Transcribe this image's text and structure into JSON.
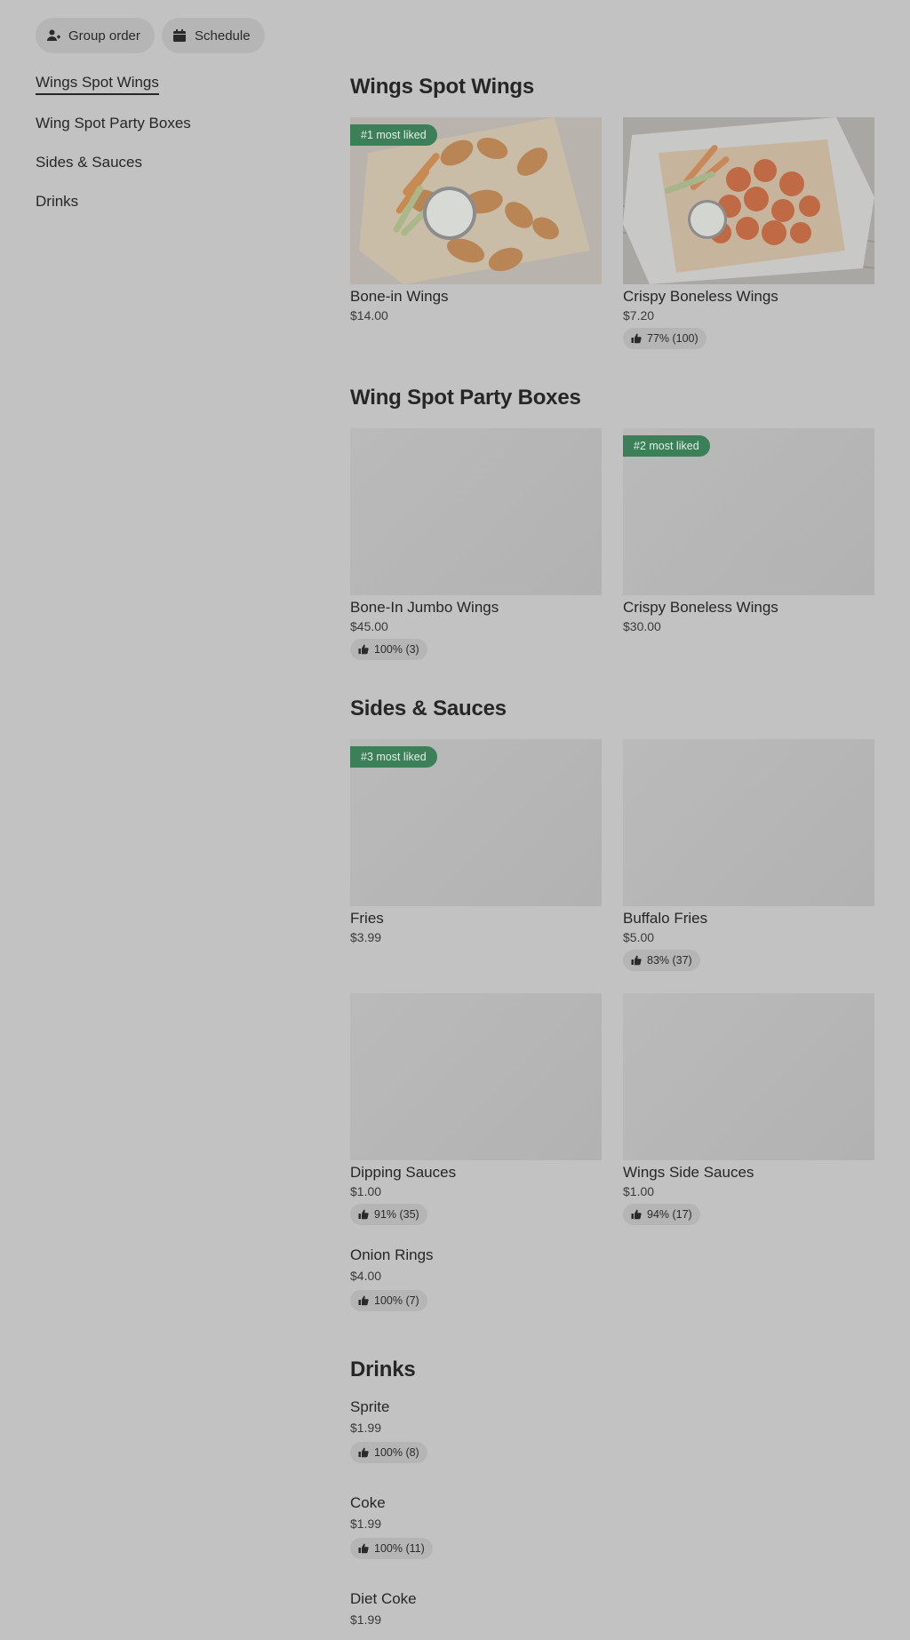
{
  "top_buttons": {
    "group_order": "Group order",
    "schedule": "Schedule"
  },
  "sidebar": {
    "items": [
      {
        "label": "Wings Spot Wings",
        "active": true
      },
      {
        "label": "Wing Spot Party Boxes",
        "active": false
      },
      {
        "label": "Sides & Sauces",
        "active": false
      },
      {
        "label": "Drinks",
        "active": false
      }
    ]
  },
  "sections": {
    "wings": {
      "title": "Wings Spot Wings",
      "items": [
        {
          "name": "Bone-in Wings",
          "price": "$14.00",
          "badge": "#1 most liked"
        },
        {
          "name": "Crispy Boneless Wings",
          "price": "$7.20",
          "rating": "77% (100)"
        }
      ]
    },
    "party_boxes": {
      "title": "Wing Spot Party Boxes",
      "items": [
        {
          "name": "Bone-In Jumbo Wings",
          "price": "$45.00",
          "rating": "100% (3)"
        },
        {
          "name": "Crispy Boneless Wings",
          "price": "$30.00",
          "badge": "#2 most liked"
        }
      ]
    },
    "sides": {
      "title": "Sides & Sauces",
      "items": [
        {
          "name": "Fries",
          "price": "$3.99",
          "badge": "#3 most liked"
        },
        {
          "name": "Buffalo Fries",
          "price": "$5.00",
          "rating": "83% (37)"
        },
        {
          "name": "Dipping Sauces",
          "price": "$1.00",
          "rating": "91% (35)"
        },
        {
          "name": "Wings Side Sauces",
          "price": "$1.00",
          "rating": "94% (17)"
        },
        {
          "name": "Onion Rings",
          "price": "$4.00",
          "rating": "100% (7)"
        }
      ]
    },
    "drinks": {
      "title": "Drinks",
      "items": [
        {
          "name": "Sprite",
          "price": "$1.99",
          "rating": "100% (8)"
        },
        {
          "name": "Coke",
          "price": "$1.99",
          "rating": "100% (11)"
        },
        {
          "name": "Diet Coke",
          "price": "$1.99"
        }
      ]
    }
  },
  "colors": {
    "background": "#c2c2c2",
    "badge": "#3b8059",
    "pill": "#b5b5b5",
    "text": "#262626"
  },
  "icons": {
    "group_order": "person-add-icon",
    "schedule": "calendar-icon",
    "rating": "thumbs-up-icon"
  }
}
